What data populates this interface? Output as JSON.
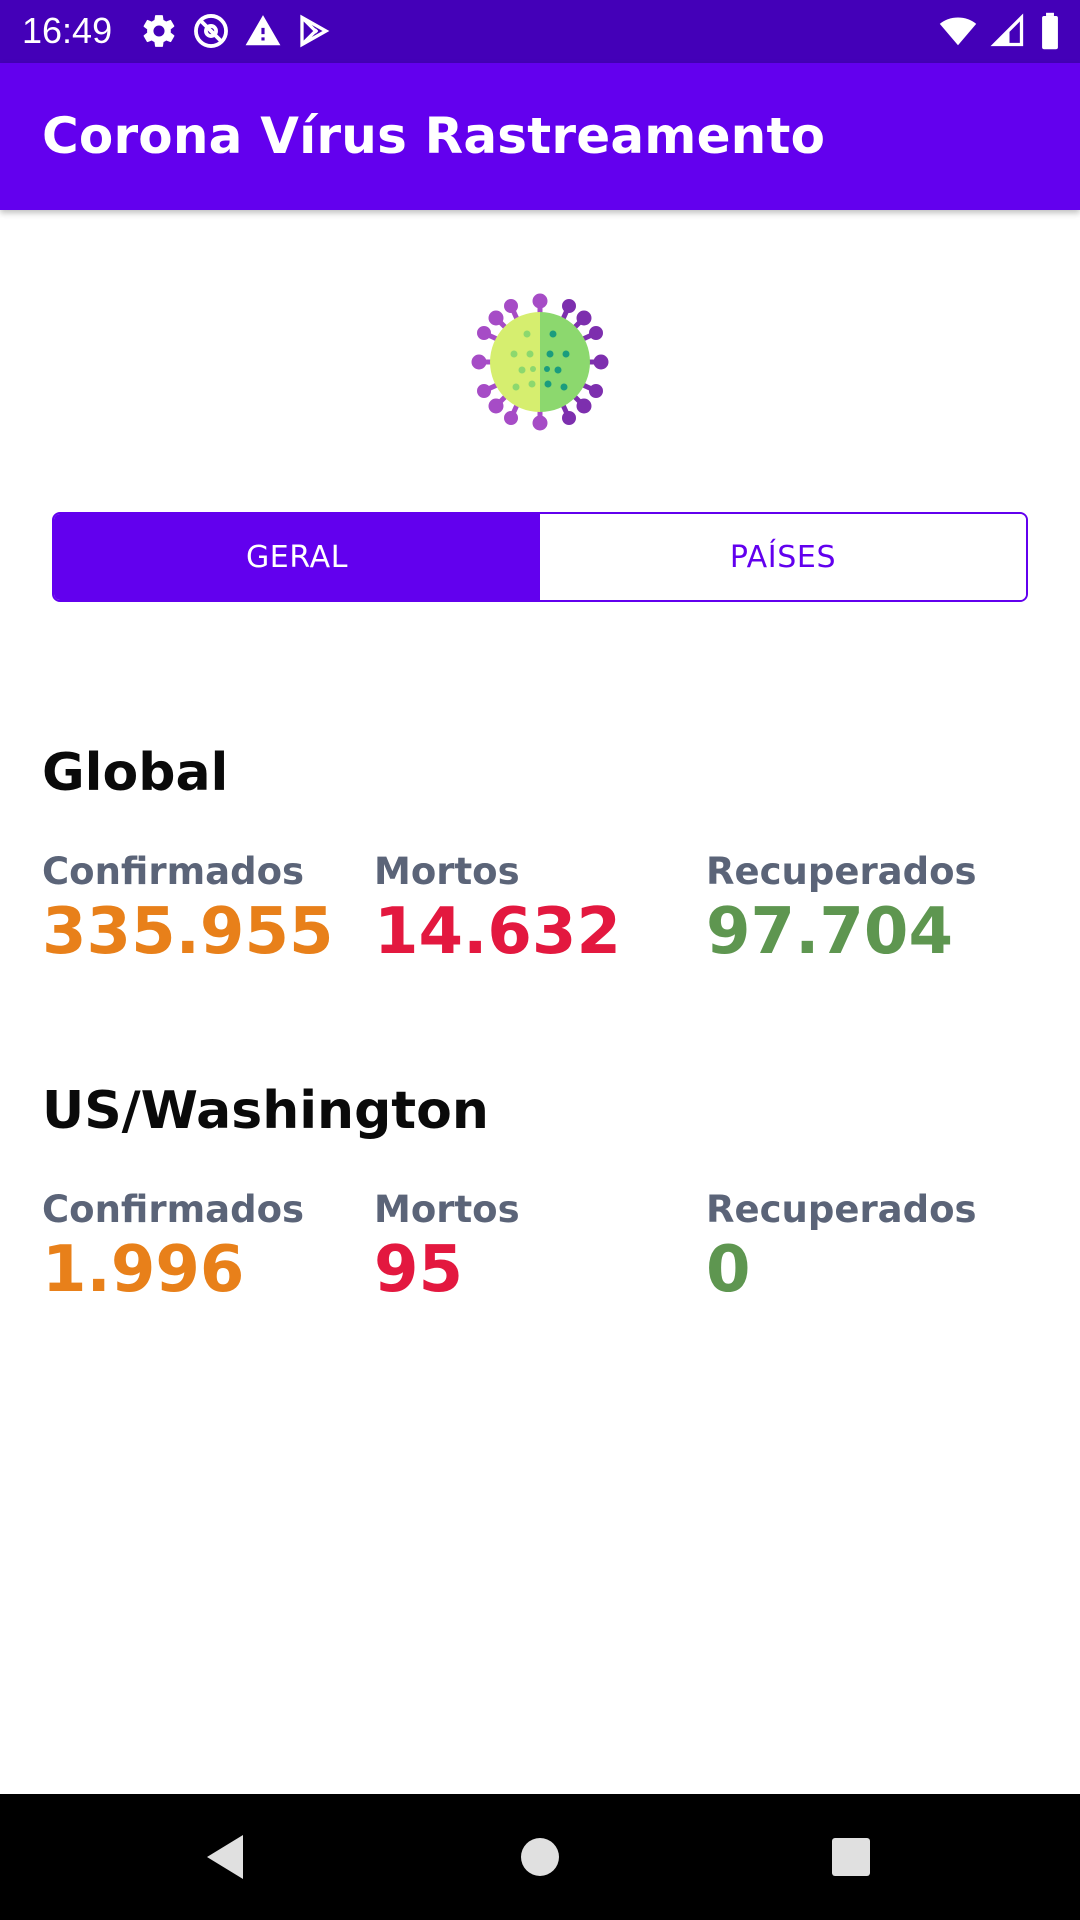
{
  "status_bar": {
    "time": "16:49",
    "left_icons": [
      "settings-icon",
      "at-sign-icon",
      "warning-icon",
      "play-store-icon"
    ],
    "right_icons": [
      "wifi-icon",
      "cell-signal-icon",
      "battery-icon"
    ]
  },
  "app_bar": {
    "title": "Corona Vírus Rastreamento",
    "background": "#6300ee"
  },
  "logo": {
    "icon": "virus-icon"
  },
  "toggle": {
    "general_label": "GERAL",
    "countries_label": "PAÍSES",
    "selected": "GERAL",
    "accent": "#6200ee"
  },
  "sections": [
    {
      "title": "Global",
      "confirmed_label": "Confirmados",
      "confirmed_value": "335.955",
      "dead_label": "Mortos",
      "dead_value": "14.632",
      "recovered_label": "Recuperados",
      "recovered_value": "97.704"
    },
    {
      "title": "US/Washington",
      "confirmed_label": "Confirmados",
      "confirmed_value": "1.996",
      "dead_label": "Mortos",
      "dead_value": "95",
      "recovered_label": "Recuperados",
      "recovered_value": "0"
    }
  ],
  "colors": {
    "confirmed": "#e8801a",
    "dead": "#e3183f",
    "recovered": "#5e9650",
    "label": "#5b6478"
  },
  "nav_bar": {
    "icons": [
      "back-icon",
      "home-icon",
      "recents-icon"
    ]
  }
}
